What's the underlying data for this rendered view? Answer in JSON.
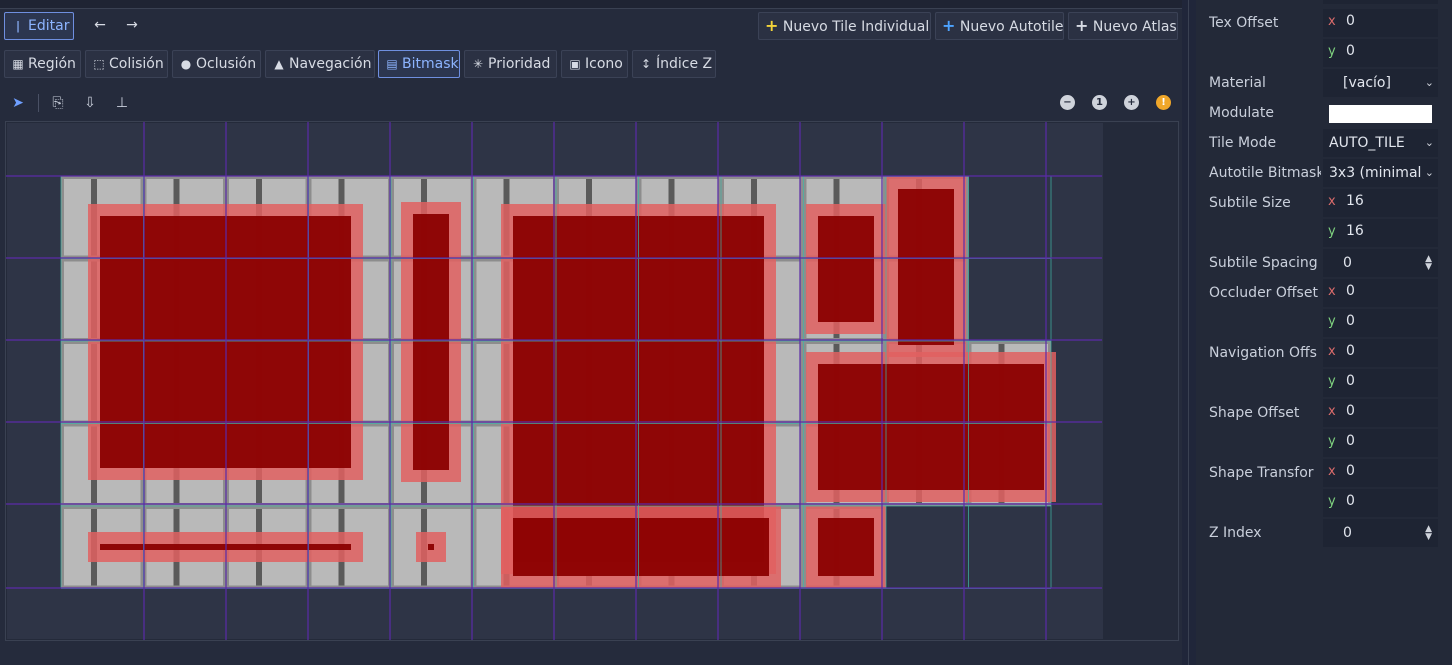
{
  "toolbar_top": {
    "edit": "Editar",
    "new_single": "Nuevo Tile Individual",
    "new_autotile": "Nuevo Autotile",
    "new_atlas": "Nuevo Atlas"
  },
  "modes": [
    "Región",
    "Colisión",
    "Oclusión",
    "Navegación",
    "Bitmask",
    "Prioridad",
    "Icono",
    "Índice Z"
  ],
  "zoom_reset": "1",
  "inspector": {
    "tex_offset": {
      "label": "Tex Offset",
      "x": "0",
      "y": "0"
    },
    "material": {
      "label": "Material",
      "value": "[vacío]"
    },
    "modulate": {
      "label": "Modulate",
      "color": "#ffffff"
    },
    "tile_mode": {
      "label": "Tile Mode",
      "value": "AUTO_TILE"
    },
    "autotile_bitmask": {
      "label": "Autotile Bitmask",
      "value": "3x3 (minimal"
    },
    "subtile_size": {
      "label": "Subtile Size",
      "x": "16",
      "y": "16"
    },
    "subtile_spacing": {
      "label": "Subtile Spacing",
      "value": "0"
    },
    "occluder_offset": {
      "label": "Occluder Offset",
      "x": "0",
      "y": "0"
    },
    "navigation_offset": {
      "label": "Navigation Offs",
      "x": "0",
      "y": "0"
    },
    "shape_offset": {
      "label": "Shape Offset",
      "x": "0",
      "y": "0"
    },
    "shape_transform": {
      "label": "Shape Transfor",
      "x": "0",
      "y": "0"
    },
    "z_index": {
      "label": "Z Index",
      "value": "0"
    }
  },
  "colors": {
    "accent": "#6f8fe0",
    "bitmask_red": "#8b0000",
    "bitmask_light": "#e06060",
    "grid_purple": "#5b2aa8",
    "grid_cyan": "#3fb7a8"
  }
}
